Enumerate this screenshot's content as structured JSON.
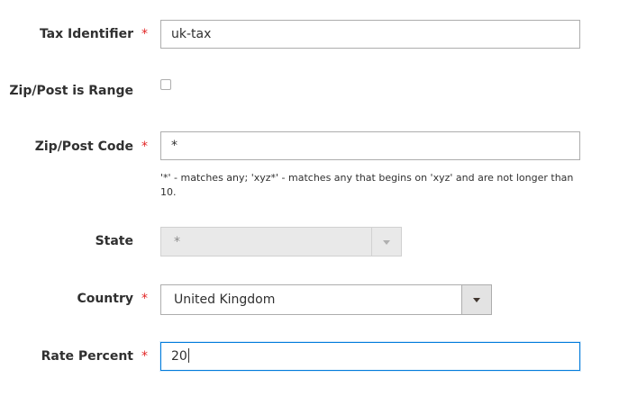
{
  "form": {
    "tax_identifier": {
      "label": "Tax Identifier",
      "required_mark": "*",
      "value": "uk-tax"
    },
    "zip_is_range": {
      "label": "Zip/Post is Range",
      "checked": false
    },
    "zip_code": {
      "label": "Zip/Post Code",
      "required_mark": "*",
      "value": "*",
      "note": "'*' - matches any; 'xyz*' - matches any that begins on 'xyz' and are not longer than 10."
    },
    "state": {
      "label": "State",
      "value": "*",
      "disabled": true
    },
    "country": {
      "label": "Country",
      "required_mark": "*",
      "value": "United Kingdom"
    },
    "rate_percent": {
      "label": "Rate Percent",
      "required_mark": "*",
      "value": "20"
    }
  },
  "colors": {
    "required": "#e22626",
    "focus_border": "#007bdb",
    "border": "#adadad",
    "text": "#303030"
  }
}
